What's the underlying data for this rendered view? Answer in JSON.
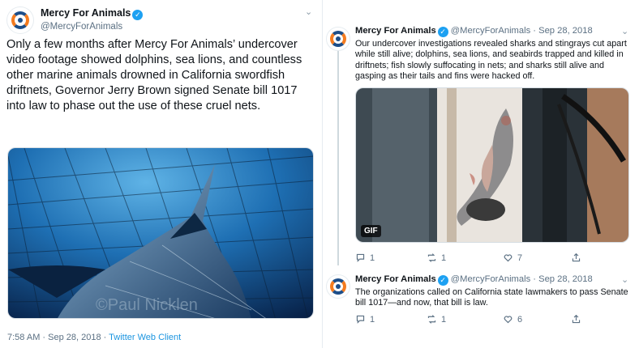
{
  "left_tweet": {
    "name": "Mercy For Animals",
    "handle": "@MercyForAnimals",
    "text": "Only a few months after Mercy For Animals’ undercover video footage showed dolphins, sea lions, and countless other marine animals drowned in California swordfish driftnets, Governor Jerry Brown signed Senate bill 1017 into law to phase out the use of these cruel nets.",
    "watermark": "©Paul Nicklen",
    "time": "7:58 AM · Sep 28, 2018 · ",
    "client": "Twitter Web Client"
  },
  "right_tweets": [
    {
      "name": "Mercy For Animals",
      "meta": "@MercyForAnimals · Sep 28, 2018",
      "text": "Our undercover investigations revealed sharks and stingrays cut apart while still alive; dolphins, sea lions, and seabirds trapped and killed in driftnets; fish slowly suffocating in nets; and sharks still alive and gasping as their tails and fins were hacked off.",
      "media_badge": "GIF",
      "replies": "1",
      "retweets": "1",
      "likes": "7"
    },
    {
      "name": "Mercy For Animals",
      "meta": "@MercyForAnimals · Sep 28, 2018",
      "text": "The organizations called on California state lawmakers to pass Senate bill 1017—and now, that bill is law.",
      "replies": "1",
      "retweets": "1",
      "likes": "6"
    }
  ],
  "colors": {
    "link": "#1b95e0",
    "verified": "#1da1f2",
    "brand_orange": "#f47c20",
    "brand_blue": "#1d4e89"
  }
}
